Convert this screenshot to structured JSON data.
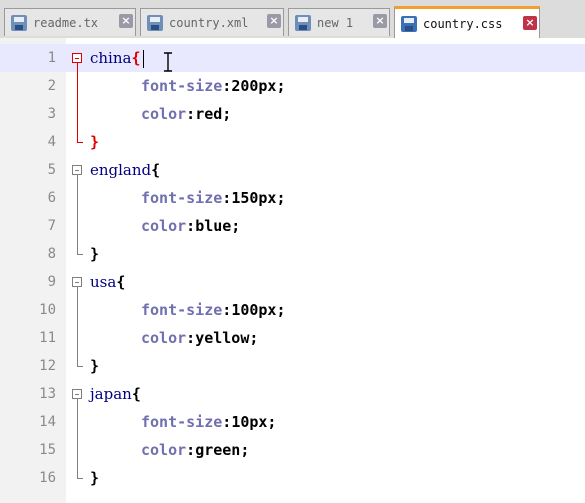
{
  "tabs": [
    {
      "label": "readme.tx",
      "active": false
    },
    {
      "label": "country.xml",
      "active": false
    },
    {
      "label": "new  1",
      "active": false
    },
    {
      "label": "country.css",
      "active": true
    }
  ],
  "line_numbers": [
    "1",
    "2",
    "3",
    "4",
    "5",
    "6",
    "7",
    "8",
    "9",
    "10",
    "11",
    "12",
    "13",
    "14",
    "15",
    "16"
  ],
  "rules": [
    {
      "selector": "china",
      "prop1": "font-size",
      "val1": "200px;",
      "prop2": "color",
      "val2": "red;"
    },
    {
      "selector": "england",
      "prop1": "font-size",
      "val1": "150px;",
      "prop2": "color",
      "val2": "blue;"
    },
    {
      "selector": "usa",
      "prop1": "font-size",
      "val1": "100px;",
      "prop2": "color",
      "val2": "yellow;"
    },
    {
      "selector": "japan",
      "prop1": "font-size",
      "val1": "10px;",
      "prop2": "color",
      "val2": "green;"
    }
  ],
  "symbols": {
    "open": "{",
    "close": "}",
    "colon": ":",
    "close_x": "×"
  },
  "colors": {
    "accent": "#f0a030",
    "highlight_brace": "#e00000",
    "selector": "#000080",
    "property": "#7070b0"
  }
}
